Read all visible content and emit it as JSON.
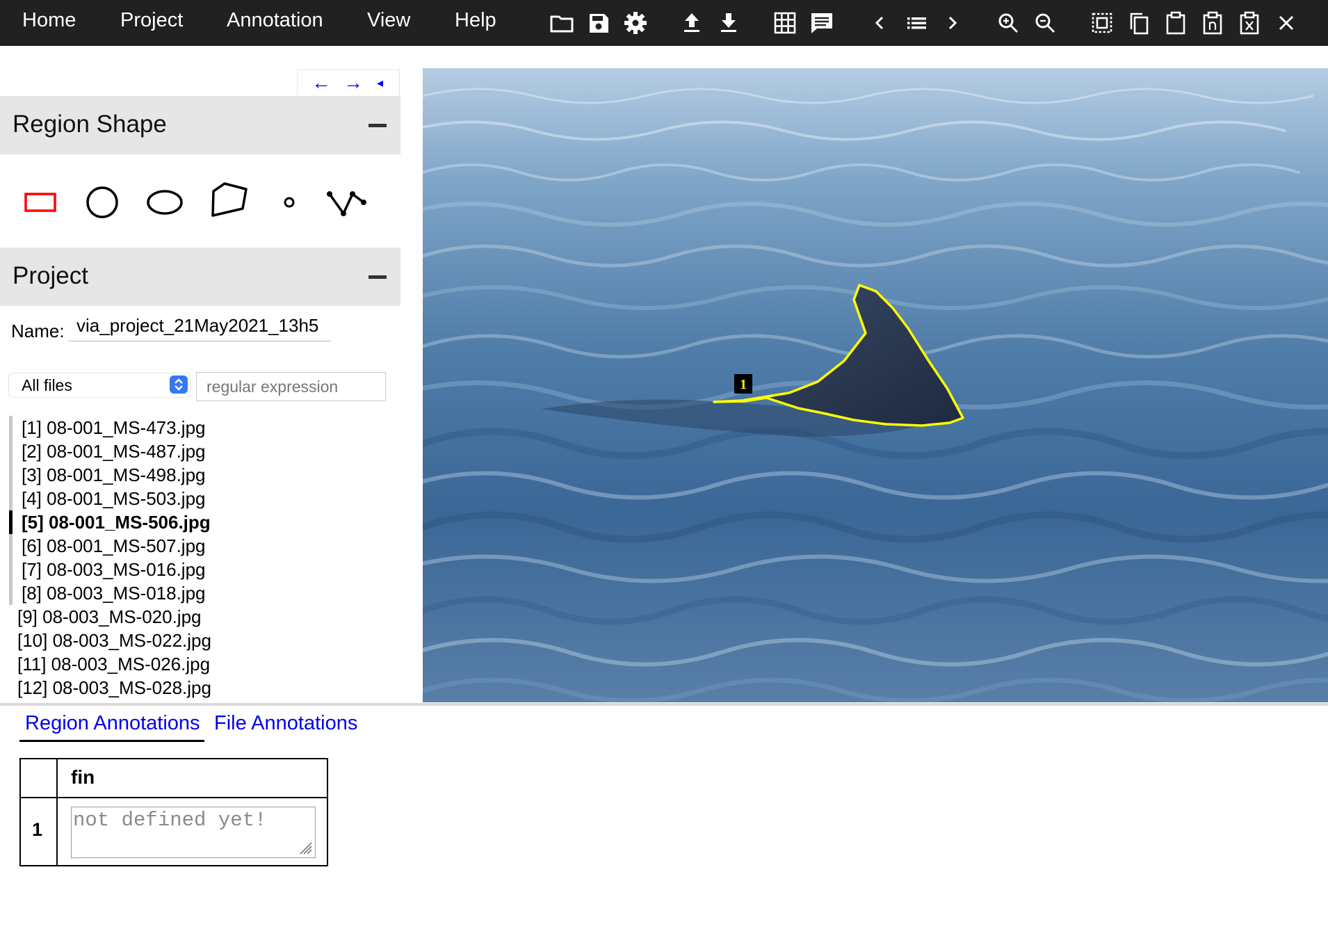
{
  "menu": [
    {
      "id": "home",
      "label": "Home"
    },
    {
      "id": "project",
      "label": "Project"
    },
    {
      "id": "annotation",
      "label": "Annotation"
    },
    {
      "id": "view",
      "label": "View"
    },
    {
      "id": "help",
      "label": "Help"
    }
  ],
  "toolbar_icons": [
    "open-folder-icon",
    "save-icon",
    "settings-icon",
    "upload-icon",
    "download-icon",
    "grid-view-icon",
    "comment-icon",
    "previous-icon",
    "list-icon",
    "next-icon",
    "zoom-in-icon",
    "zoom-out-icon",
    "select-all-icon",
    "copy-icon",
    "paste-icon",
    "paste-n-icon",
    "delete-region-icon",
    "close-icon"
  ],
  "panel_nav": {
    "prev": "←",
    "next": "→",
    "toggle": "◂"
  },
  "region_shape": {
    "title": "Region Shape",
    "tools": [
      "rectangle",
      "circle",
      "ellipse",
      "polygon",
      "point",
      "polyline"
    ],
    "selected": "rectangle",
    "selected_color": "#ff0000"
  },
  "project": {
    "title": "Project",
    "name_label": "Name:",
    "name_value": "via_project_21May2021_13h5",
    "filter_selected": "All files",
    "regex_placeholder": "regular expression",
    "files": [
      "[1] 08-001_MS-473.jpg",
      "[2] 08-001_MS-487.jpg",
      "[3] 08-001_MS-498.jpg",
      "[4] 08-001_MS-503.jpg",
      "[5] 08-001_MS-506.jpg",
      "[6] 08-001_MS-507.jpg",
      "[7] 08-003_MS-016.jpg",
      "[8] 08-003_MS-018.jpg",
      "[9] 08-003_MS-020.jpg",
      "[10] 08-003_MS-022.jpg",
      "[11] 08-003_MS-026.jpg",
      "[12] 08-003_MS-028.jpg"
    ],
    "current_index": 4
  },
  "canvas": {
    "region_label": "1",
    "region_color": "#ffff00"
  },
  "editor": {
    "tabs": [
      "Region Annotations",
      "File Annotations"
    ],
    "active_tab": "Region Annotations",
    "column_header": "fin",
    "row_id": "1",
    "placeholder": "not defined yet!"
  }
}
